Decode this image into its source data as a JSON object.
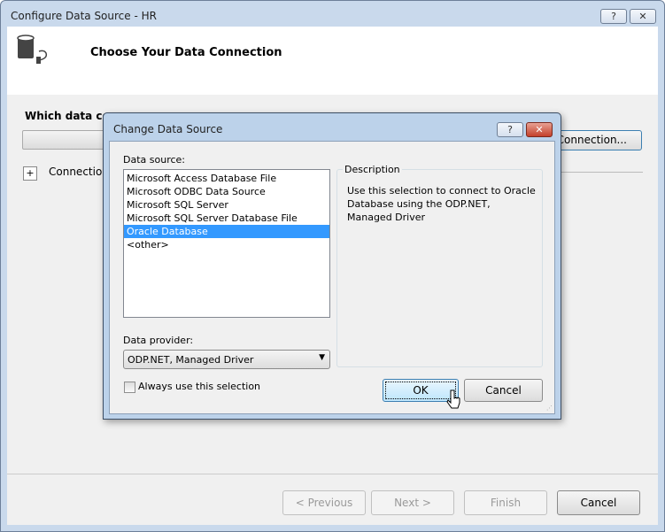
{
  "window": {
    "title": "Configure Data Source - HR",
    "help": "?",
    "close": "✕"
  },
  "header": {
    "title": "Choose Your Data Connection"
  },
  "main": {
    "question": "Which data conn",
    "new_connection": "Connection...",
    "expand": "+",
    "connection_string": "Connection"
  },
  "footer": {
    "previous": "< Previous",
    "next": "Next >",
    "finish": "Finish",
    "cancel": "Cancel"
  },
  "dialog": {
    "title": "Change Data Source",
    "help": "?",
    "close": "✕",
    "data_source_label": "Data source:",
    "sources": [
      "Microsoft Access Database File",
      "Microsoft ODBC Data Source",
      "Microsoft SQL Server",
      "Microsoft SQL Server Database File",
      "Oracle Database",
      "<other>"
    ],
    "selected_index": 4,
    "description_label": "Description",
    "description": "Use this selection to connect to Oracle Database using the ODP.NET, Managed Driver",
    "provider_label": "Data provider:",
    "provider_value": "ODP.NET, Managed Driver",
    "always_use": "Always use this selection",
    "always_checked": false,
    "ok": "OK",
    "cancel": "Cancel"
  }
}
